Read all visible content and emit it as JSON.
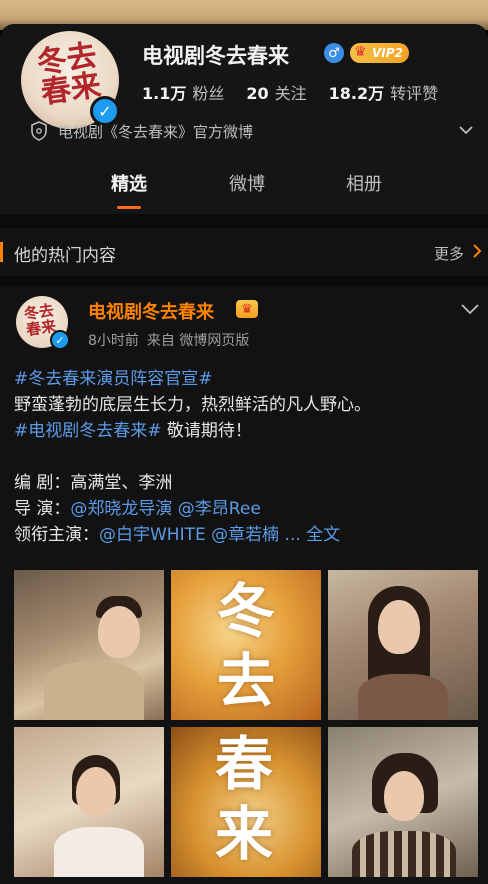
{
  "profile": {
    "name": "电视剧冬去春来",
    "avatar_text": "冬去春来",
    "vip_label": "VIP2",
    "stats": [
      {
        "num": "1.1万",
        "label": "粉丝"
      },
      {
        "num": "20",
        "label": "关注"
      },
      {
        "num": "18.2万",
        "label": "转评赞"
      }
    ],
    "intro": "电视剧《冬去春来》官方微博"
  },
  "tabs": [
    {
      "label": "精选",
      "active": true
    },
    {
      "label": "微博",
      "active": false
    },
    {
      "label": "相册",
      "active": false
    }
  ],
  "hot_section": {
    "title": "他的热门内容",
    "more": "更多"
  },
  "post": {
    "author": "电视剧冬去春来",
    "time": "8小时前",
    "source": "来自 微博网页版",
    "lines": {
      "l1_tag": "#冬去春来演员阵容官宣#",
      "l2": "野蛮蓬勃的底层生长力，热烈鲜活的凡人野心。",
      "l3_tag": "#电视剧冬去春来#",
      "l3_text": " 敬请期待！",
      "l5_label": "编 剧：",
      "l5_text": "高满堂、李洲",
      "l6_label": "导 演：",
      "l6_mentions": "@郑晓龙导演 @李昂Ree",
      "l7_label": "领衔主演：",
      "l7_mentions": "@白宇WHITE @章若楠",
      "l7_more": " ... 全文"
    },
    "poster_text_top": "冬去",
    "poster_text_bottom": "春来"
  },
  "colors": {
    "accent": "#ff8200",
    "link": "#5c9be8",
    "verify": "#1d9bf0"
  }
}
